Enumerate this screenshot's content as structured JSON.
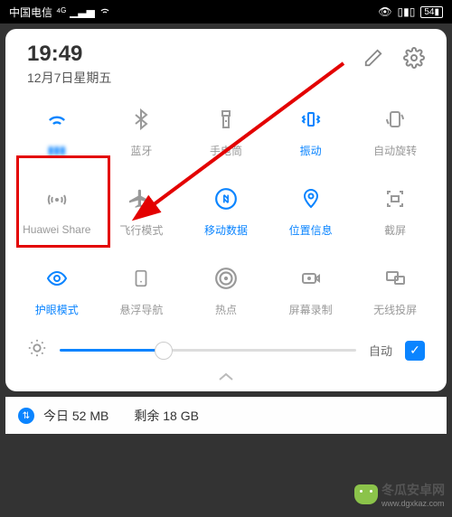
{
  "status": {
    "carrier": "中国电信",
    "net": "⁴ᴳ",
    "battery": "54"
  },
  "header": {
    "time": "19:49",
    "date": "12月7日星期五"
  },
  "tiles": {
    "wifi": "▮▮▮",
    "bluetooth": "蓝牙",
    "flashlight": "手电筒",
    "vibrate": "振动",
    "autorotate": "自动旋转",
    "huawei_share": "Huawei Share",
    "airplane": "飞行模式",
    "mobile_data": "移动数据",
    "location": "位置信息",
    "screenshot": "截屏",
    "eye_comfort": "护眼模式",
    "floating_nav": "悬浮导航",
    "hotspot": "热点",
    "screen_record": "屏幕录制",
    "wireless_proj": "无线投屏"
  },
  "brightness": {
    "auto": "自动"
  },
  "bottom": {
    "today": "今日 52 MB",
    "remaining": "剩余 18 GB"
  },
  "watermark": {
    "text": "冬瓜安卓网",
    "url": "www.dgxkaz.com"
  }
}
